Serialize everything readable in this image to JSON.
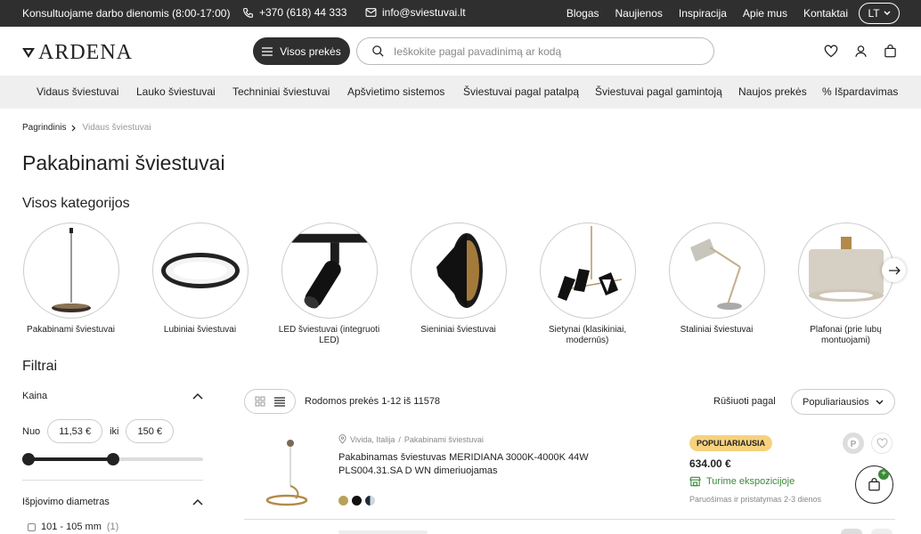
{
  "topbar": {
    "hours": "Konsultuojame darbo dienomis (8:00-17:00)",
    "phone": "+370 (618) 44 333",
    "email": "info@sviestuvai.lt",
    "links": [
      "Blogas",
      "Naujienos",
      "Inspiracija",
      "Apie mus",
      "Kontaktai"
    ],
    "lang": "LT"
  },
  "header": {
    "logo": "ARDENA",
    "all_products": "Visos prekės",
    "search_placeholder": "Ieškokite pagal pavadinimą ar kodą"
  },
  "nav": [
    "Vidaus šviestuvai",
    "Lauko šviestuvai",
    "Techniniai šviestuvai",
    "Apšvietimo sistemos",
    "Šviestuvai pagal patalpą",
    "Šviestuvai pagal gamintoją",
    "Naujos prekės",
    "% Išpardavimas"
  ],
  "breadcrumb": {
    "home": "Pagrindinis",
    "current": "Vidaus šviestuvai"
  },
  "page_title": "Pakabinami šviestuvai",
  "categories_title": "Visos kategorijos",
  "categories": [
    {
      "label": "Pakabinami šviestuvai"
    },
    {
      "label": "Lubiniai šviestuvai"
    },
    {
      "label": "LED šviestuvai (integruoti LED)"
    },
    {
      "label": "Sieniniai šviestuvai"
    },
    {
      "label": "Sietynai (klasikiniai, modernūs)"
    },
    {
      "label": "Staliniai šviestuvai"
    },
    {
      "label": "Plafonai (prie lubų montuojami)"
    }
  ],
  "filters": {
    "title": "Filtrai",
    "price": {
      "label": "Kaina",
      "from_label": "Nuo",
      "from": "11,53 €",
      "to_label": "iki",
      "to": "150 €"
    },
    "diameter": {
      "label": "Išpjovimo diametras",
      "option": "101 - 105 mm",
      "count": "(1)"
    }
  },
  "toolbar": {
    "showing": "Rodomos prekės 1-12 iš 11578",
    "sort_label": "Rūšiuoti pagal",
    "sort_value": "Populiariausios"
  },
  "product": {
    "location": "Vivida, Italija",
    "category": "Pakabinami šviestuvai",
    "name": "Pakabinamas šviestuvas MERIDIANA 3000K-4000K 44W PLS004.31.SA D WN dimeriuojamas",
    "badge": "POPULIARIAUSIA",
    "price": "634.00 €",
    "stock": "Turime ekspozicijoje",
    "shipping": "Paruošimas ir pristatymas 2-3 dienos",
    "swatches": [
      "#b8a25a",
      "#111111",
      "#6d8fb0"
    ]
  },
  "colors": {
    "dark": "#2f2f2f",
    "nav_bg": "#efefef",
    "badge": "#f6d27e",
    "green": "#3a8a3a"
  }
}
